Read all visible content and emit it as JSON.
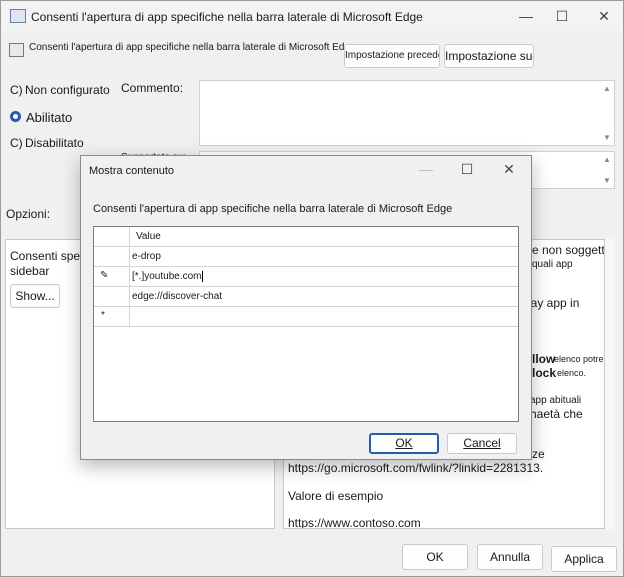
{
  "window": {
    "title": "Consenti l'apertura di app specifiche nella barra laterale di Microsoft Edge",
    "controls": [
      "—",
      "☐",
      "✕"
    ]
  },
  "header": {
    "policy_name": "Consenti l'apertura di app specifiche nella barra laterale di Microsoft Edge",
    "prev_button": "Impostazione precedente",
    "next_button": "Impostazione successiva"
  },
  "state": {
    "not_configured": "Non configurato",
    "enabled": "Abilitato",
    "disabled": "Disabilitato",
    "selected": "enabled"
  },
  "comment_label": "Commento:",
  "supported_label_fragment": "Supportato su:",
  "options_label": "Opzioni:",
  "options_panel": {
    "label_line1": "Consenti specifico",
    "label_line2": "sidebar",
    "show_button": "Show..."
  },
  "help_panel": {
    "frag1": "e non soggetto",
    "frag2": "quali app",
    "frag3": "gay app in",
    "frag4a": "llow",
    "frag4b": "elenco potrebbe",
    "frag5a": "lock",
    "frag5b": "elenco.",
    "frag6": "app abituali",
    "frag7": "haetà che",
    "frag8": "ze",
    "link_line": "https://go.microsoft.com/fwlink/?linkid=2281313.",
    "example_heading": "Valore di esempio",
    "example_value": "https://www.contoso.com"
  },
  "footer": {
    "ok": "OK",
    "cancel": "Annulla",
    "apply": "Applica"
  },
  "dialog": {
    "title": "Mostra contenuto",
    "description": "Consenti l'apertura di app specifiche nella barra laterale di Microsoft Edge",
    "column_header": "Value",
    "rows": [
      "e-drop",
      "[*.]youtube.com",
      "edge://discover-chat",
      ""
    ],
    "row_markers": [
      "",
      "✎",
      "",
      "*"
    ],
    "ok": "OK",
    "cancel": "Cancel"
  },
  "colors": {
    "accent": "#1f5fa8",
    "link": "#0b63c7"
  }
}
